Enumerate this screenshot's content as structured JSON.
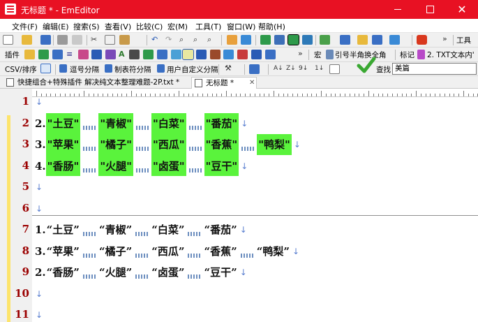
{
  "window": {
    "title": "无标题 * - EmEditor",
    "close_glyph": "✕"
  },
  "menu": [
    {
      "label": "文件(F)"
    },
    {
      "label": "编辑(E)"
    },
    {
      "label": "搜索(S)"
    },
    {
      "label": "查看(V)"
    },
    {
      "label": "比较(C)"
    },
    {
      "label": "宏(M)"
    },
    {
      "label": "工具(T)"
    },
    {
      "label": "窗口(W)"
    },
    {
      "label": "帮助(H)"
    }
  ],
  "toolbar1": {
    "more": "»",
    "tools_label": "工具"
  },
  "toolbar2": {
    "plugins_label": "插件",
    "more": "»",
    "macro_label": "宏",
    "macro_name": "引号半角换全角",
    "marker_label": "标记",
    "marker_item": "2. TXT文本内'"
  },
  "toolbar3": {
    "csv_label": "CSV/排序",
    "comma_label": "逗号分隔",
    "tab_label": "制表符分隔",
    "custom_label": "用户自定义分隔",
    "search_label": "查找",
    "search_value": "美篇"
  },
  "tabs": [
    {
      "label": "快捷组合+特殊插件 解决纯文本整理难题-2P.txt *"
    },
    {
      "label": "无标题 *",
      "close": "✕"
    }
  ],
  "editor": {
    "line_numbers": [
      "1",
      "2",
      "3",
      "4",
      "5",
      "6",
      "7",
      "8",
      "9",
      "10",
      "11"
    ],
    "eol_mark": "↓",
    "top_rows": [
      {
        "num": "2.",
        "items": [
          "\"土豆\"",
          "\"青椒\"",
          "\"白菜\"",
          "\"番茄\""
        ]
      },
      {
        "num": "3.",
        "items": [
          "\"苹果\"",
          "\"橘子\"",
          "\"西瓜\"",
          "\"香蕉\"",
          "\"鸭梨\""
        ]
      },
      {
        "num": "4.",
        "items": [
          "\"香肠\"",
          "\"火腿\"",
          "\"卤蛋\"",
          "\"豆干\""
        ]
      }
    ],
    "bottom_rows": [
      {
        "num": "1.",
        "items": [
          "“土豆”",
          "“青椒”",
          "“白菜”",
          "“番茄”"
        ]
      },
      {
        "num": "3.",
        "items": [
          "“苹果”",
          "“橘子”",
          "“西瓜”",
          "“香蕉”",
          "“鸭梨”"
        ]
      },
      {
        "num": "2.",
        "items": [
          "“香肠”",
          "“火腿”",
          "“卤蛋”",
          "“豆干”"
        ]
      }
    ]
  },
  "colors": {
    "titlebar": "#e81123",
    "highlight": "#5af33c",
    "line_number": "#9b0000",
    "modified_bar": "#fde46b"
  }
}
